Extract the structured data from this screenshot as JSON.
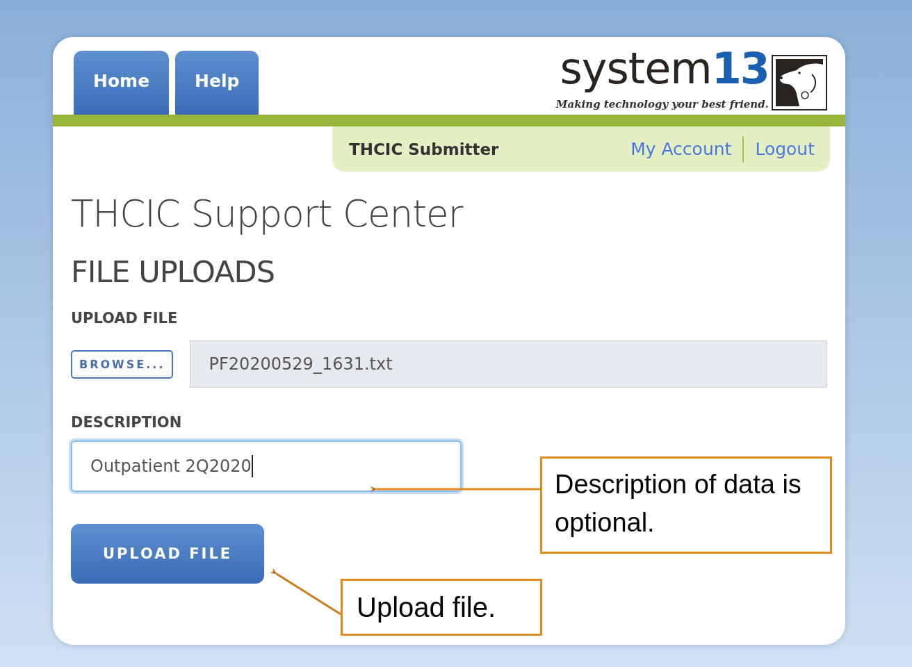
{
  "nav_tabs": [
    {
      "label": "Home"
    },
    {
      "label": "Help"
    }
  ],
  "logo": {
    "word": "system",
    "number": "13",
    "tagline": "Making technology your best friend."
  },
  "user_bar": {
    "role": "THCIC Submitter",
    "links": [
      "My Account",
      "Logout"
    ]
  },
  "title": "THCIC Support Center",
  "section_title": "FILE UPLOADS",
  "upload_file": {
    "label": "UPLOAD FILE",
    "browse_button": "BROWSE...",
    "file_name": "PF20200529_1631.txt"
  },
  "description": {
    "label": "DESCRIPTION",
    "value": "Outpatient 2Q2020",
    "focused": true
  },
  "upload_button": "UPLOAD FILE",
  "callouts": [
    {
      "text": "Description of data is optional."
    },
    {
      "text": "Upload file."
    }
  ]
}
